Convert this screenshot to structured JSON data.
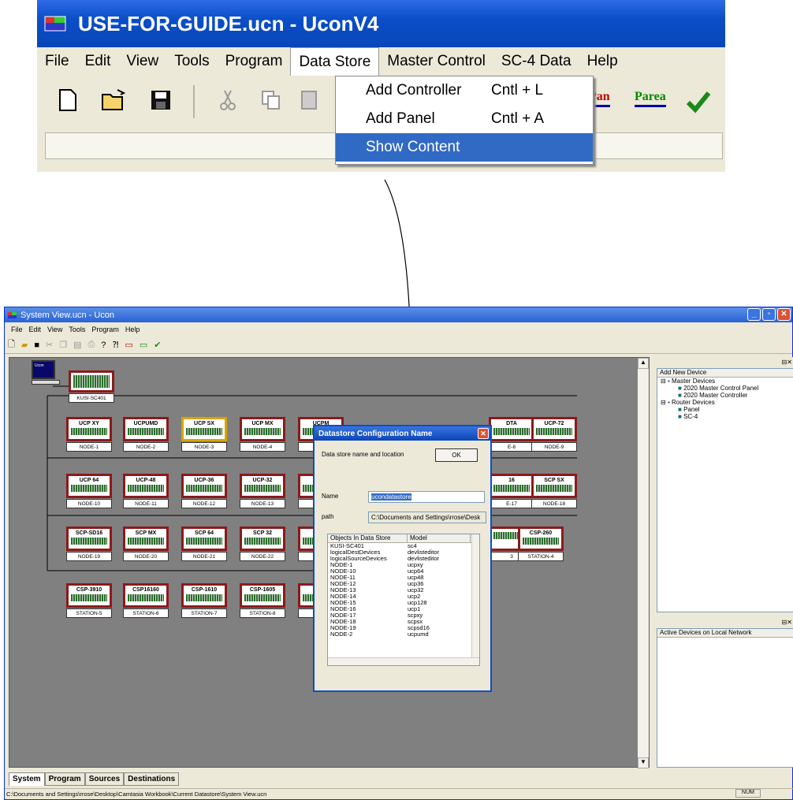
{
  "zoom": {
    "title": "USE-FOR-GUIDE.ucn - UconV4",
    "menu": [
      "File",
      "Edit",
      "View",
      "Tools",
      "Program",
      "Data Store",
      "Master Control",
      "SC-4 Data",
      "Help"
    ],
    "dropdown": [
      {
        "label": "Add Controller",
        "shortcut": "Cntl + L"
      },
      {
        "label": "Add Panel",
        "shortcut": "Cntl + A"
      },
      {
        "label": "Show Content",
        "shortcut": ""
      }
    ],
    "toolbar_text": {
      "pan": "Pan",
      "parea": "Parea"
    }
  },
  "window": {
    "title": "System View.ucn - Ucon",
    "menu": [
      "File",
      "Edit",
      "View",
      "Tools",
      "Program",
      "Help"
    ],
    "controller": {
      "screen": "Ucon",
      "label": "KUSI-SC401"
    },
    "rows": [
      [
        {
          "t": "UCP XY",
          "n": "NODE-1"
        },
        {
          "t": "UCPUMD",
          "n": "NODE-2"
        },
        {
          "t": "UCP SX",
          "n": "NODE-3"
        },
        {
          "t": "UCP MX",
          "n": "NODE-4"
        },
        {
          "t": "UCPM",
          "n": "NODE"
        },
        {
          "t": "DTA",
          "n": "E-8"
        },
        {
          "t": "UCP-72",
          "n": "NODE-9"
        }
      ],
      [
        {
          "t": "UCP 64",
          "n": "NODE-10"
        },
        {
          "t": "UCP-48",
          "n": "NODE-11"
        },
        {
          "t": "UCP-36",
          "n": "NODE-12"
        },
        {
          "t": "UCP-32",
          "n": "NODE-13"
        },
        {
          "t": "UCP",
          "n": "NODE"
        },
        {
          "t": "16",
          "n": "E-17"
        },
        {
          "t": "SCP SX",
          "n": "NODE-18"
        }
      ],
      [
        {
          "t": "SCP-SD16",
          "n": "NODE-19"
        },
        {
          "t": "SCP MX",
          "n": "NODE-20"
        },
        {
          "t": "SCP 64",
          "n": "NODE-21"
        },
        {
          "t": "SCP 32",
          "n": "NODE-22"
        },
        {
          "t": "SCP",
          "n": "NODE"
        },
        {
          "t": "",
          "n": "3"
        },
        {
          "t": "CSP-260",
          "n": "STATION-4"
        }
      ],
      [
        {
          "t": "CSP-3910",
          "n": "STATION-5"
        },
        {
          "t": "CSP16160",
          "n": "STATION-6"
        },
        {
          "t": "CSP-1610",
          "n": "STATION-7"
        },
        {
          "t": "CSP-1605",
          "n": "STATION-8"
        },
        {
          "t": "CSP 1",
          "n": "STATI"
        }
      ]
    ],
    "dialog": {
      "title": "Datastore Configuration Name",
      "desc": "Data store name and location",
      "ok": "OK",
      "name_label": "Name",
      "name_value": "ucondatastore",
      "path_label": "path",
      "path_value": "C:\\Documents and Settings\\rrose\\Desk",
      "col1": "Objects In Data Store",
      "col2": "Model",
      "rows": [
        [
          "KUSI-SC401",
          "sc4"
        ],
        [
          "logicalDestDevices",
          "devlisteditor"
        ],
        [
          "logicalSourceDevices",
          "devlisteditor"
        ],
        [
          "NODE-1",
          "ucpxy"
        ],
        [
          "NODE-10",
          "ucp64"
        ],
        [
          "NODE-11",
          "ucp48"
        ],
        [
          "NODE-12",
          "ucp36"
        ],
        [
          "NODE-13",
          "ucp32"
        ],
        [
          "NODE-14",
          "ucp2"
        ],
        [
          "NODE-15",
          "ucp128"
        ],
        [
          "NODE-16",
          "ucp1"
        ],
        [
          "NODE-17",
          "scpxy"
        ],
        [
          "NODE-18",
          "scpsx"
        ],
        [
          "NODE-19",
          "scpsd16"
        ],
        [
          "NODE-2",
          "ucpumd"
        ]
      ]
    },
    "add_new": {
      "header": "Add New Device",
      "master": "Master Devices",
      "master_items": [
        "2020 Master Control Panel",
        "2020 Master Controller"
      ],
      "router": "Router Devices",
      "router_items": [
        "Panel",
        "SC-4"
      ]
    },
    "active_header": "Active Devices on Local Network",
    "tabs": [
      "System",
      "Program",
      "Sources",
      "Destinations"
    ],
    "status": "C:\\Documents and Settings\\rrose\\Desktop\\Camtasia Workbook\\Current Datastore\\System View.ucn",
    "num": "NUM"
  }
}
